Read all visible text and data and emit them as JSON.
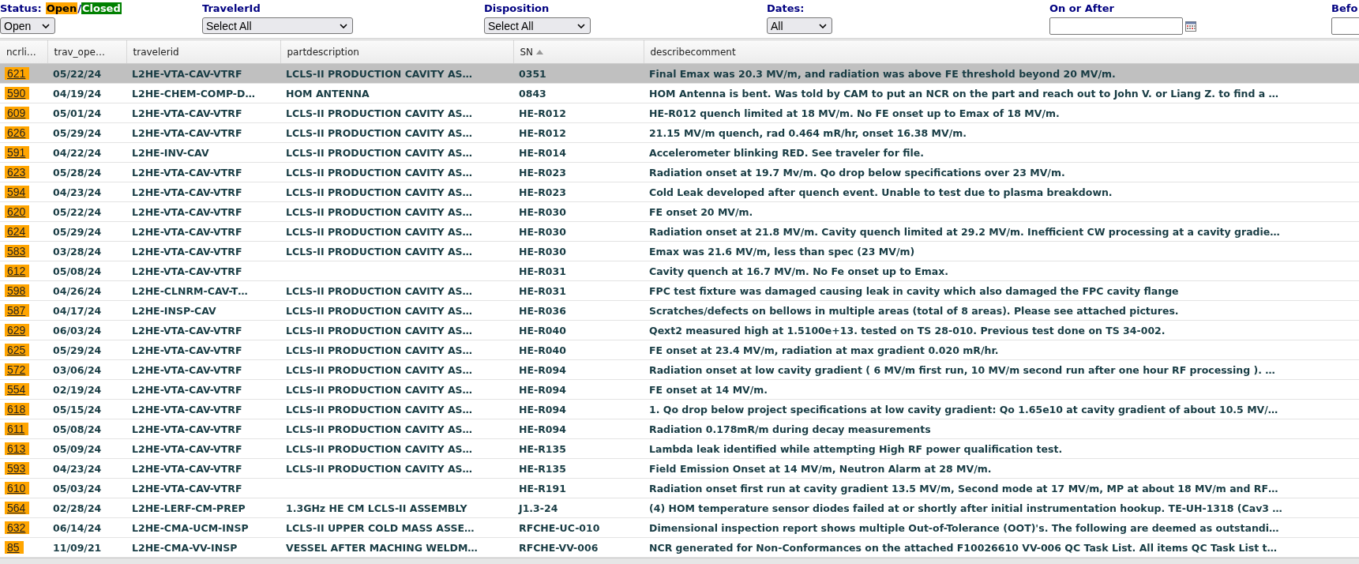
{
  "filters": {
    "status": {
      "label": "Status:",
      "legend": [
        {
          "text": "Open",
          "color": "#ffa500"
        },
        {
          "text": "Closed",
          "color": "#008000"
        }
      ],
      "separator": "/",
      "value": "Open"
    },
    "selects": [
      {
        "label": "TravelerId",
        "value": "Select All"
      },
      {
        "label": "Disposition",
        "value": "Select All"
      },
      {
        "label": "Dates:",
        "value": "All"
      }
    ],
    "date_fields": [
      {
        "label": "On or After",
        "calendar": true
      },
      {
        "label": "Befo"
      }
    ]
  },
  "table": {
    "columns": [
      {
        "label": "ncrli…"
      },
      {
        "label": "trav_ope…"
      },
      {
        "label": "travelerid"
      },
      {
        "label": "partdescription"
      },
      {
        "label": "SN",
        "sorted": true
      },
      {
        "label": "describecomment"
      }
    ],
    "rows": [
      {
        "selected": true,
        "cells": [
          "621",
          "05/22/24",
          "L2HE-VTA-CAV-VTRF",
          "LCLS-II PRODUCTION CAVITY AS…",
          "0351",
          "Final Emax was 20.3 MV/m, and radiation was above FE threshold beyond 20 MV/m."
        ]
      },
      {
        "selected": false,
        "cells": [
          "590",
          "04/19/24",
          "L2HE-CHEM-COMP-D…",
          "HOM ANTENNA",
          "0843",
          "HOM Antenna is bent. Was told by CAM to put an NCR on the part and reach out to John V. or Liang Z. to find a …"
        ]
      },
      {
        "selected": false,
        "cells": [
          "609",
          "05/01/24",
          "L2HE-VTA-CAV-VTRF",
          "LCLS-II PRODUCTION CAVITY AS…",
          "HE-R012",
          "HE-R012 quench limited at 18 MV/m. No FE onset up to Emax of 18 MV/m."
        ]
      },
      {
        "selected": false,
        "cells": [
          "626",
          "05/29/24",
          "L2HE-VTA-CAV-VTRF",
          "LCLS-II PRODUCTION CAVITY AS…",
          "HE-R012",
          "21.15 MV/m quench, rad 0.464 mR/hr, onset 16.38 MV/m."
        ]
      },
      {
        "selected": false,
        "cells": [
          "591",
          "04/22/24",
          "L2HE-INV-CAV",
          "LCLS-II PRODUCTION CAVITY AS…",
          "HE-R014",
          "Accelerometer blinking RED. See traveler for file."
        ]
      },
      {
        "selected": false,
        "cells": [
          "623",
          "05/28/24",
          "L2HE-VTA-CAV-VTRF",
          "LCLS-II PRODUCTION CAVITY AS…",
          "HE-R023",
          "Radiation onset at 19.7 Mv/m. Qo drop below specifications over 23 MV/m."
        ]
      },
      {
        "selected": false,
        "cells": [
          "594",
          "04/23/24",
          "L2HE-VTA-CAV-VTRF",
          "LCLS-II PRODUCTION CAVITY AS…",
          "HE-R023",
          "Cold Leak developed after quench event. Unable to test due to plasma breakdown."
        ]
      },
      {
        "selected": false,
        "cells": [
          "620",
          "05/22/24",
          "L2HE-VTA-CAV-VTRF",
          "LCLS-II PRODUCTION CAVITY AS…",
          "HE-R030",
          "FE onset 20 MV/m."
        ]
      },
      {
        "selected": false,
        "cells": [
          "624",
          "05/29/24",
          "L2HE-VTA-CAV-VTRF",
          "LCLS-II PRODUCTION CAVITY AS…",
          "HE-R030",
          "Radiation onset at 21.8 MV/m. Cavity quench limited at 29.2 MV/m. Inefficient CW processing at a cavity gradie…"
        ]
      },
      {
        "selected": false,
        "cells": [
          "583",
          "03/28/24",
          "L2HE-VTA-CAV-VTRF",
          "LCLS-II PRODUCTION CAVITY AS…",
          "HE-R030",
          "Emax was 21.6 MV/m, less than spec (23 MV/m)"
        ]
      },
      {
        "selected": false,
        "cells": [
          "612",
          "05/08/24",
          "L2HE-VTA-CAV-VTRF",
          "",
          "HE-R031",
          "Cavity quench at 16.7 MV/m. No Fe onset up to Emax."
        ]
      },
      {
        "selected": false,
        "cells": [
          "598",
          "04/26/24",
          "L2HE-CLNRM-CAV-T…",
          "LCLS-II PRODUCTION CAVITY AS…",
          "HE-R031",
          "FPC test fixture was damaged causing leak in cavity which also damaged the FPC cavity flange"
        ]
      },
      {
        "selected": false,
        "cells": [
          "587",
          "04/17/24",
          "L2HE-INSP-CAV",
          "LCLS-II PRODUCTION CAVITY AS…",
          "HE-R036",
          "Scratches/defects on bellows in multiple areas (total of 8 areas). Please see attached pictures."
        ]
      },
      {
        "selected": false,
        "cells": [
          "629",
          "06/03/24",
          "L2HE-VTA-CAV-VTRF",
          "LCLS-II PRODUCTION CAVITY AS…",
          "HE-R040",
          "Qext2 measured high at 1.5100e+13. tested on TS 28-010. Previous test done on TS 34-002."
        ]
      },
      {
        "selected": false,
        "cells": [
          "625",
          "05/29/24",
          "L2HE-VTA-CAV-VTRF",
          "LCLS-II PRODUCTION CAVITY AS…",
          "HE-R040",
          "FE onset at 23.4 MV/m, radiation at max gradient 0.020 mR/hr."
        ]
      },
      {
        "selected": false,
        "cells": [
          "572",
          "03/06/24",
          "L2HE-VTA-CAV-VTRF",
          "LCLS-II PRODUCTION CAVITY AS…",
          "HE-R094",
          "Radiation onset at low cavity gradient ( 6 MV/m first run, 10 MV/m second run after one hour RF processing ). …"
        ]
      },
      {
        "selected": false,
        "cells": [
          "554",
          "02/19/24",
          "L2HE-VTA-CAV-VTRF",
          "LCLS-II PRODUCTION CAVITY AS…",
          "HE-R094",
          "FE onset at 14 MV/m."
        ]
      },
      {
        "selected": false,
        "cells": [
          "618",
          "05/15/24",
          "L2HE-VTA-CAV-VTRF",
          "LCLS-II PRODUCTION CAVITY AS…",
          "HE-R094",
          "1. Qo drop below project specifications at low cavity gradient: Qo 1.65e10 at cavity gradient of about 10.5 MV/…"
        ]
      },
      {
        "selected": false,
        "cells": [
          "611",
          "05/08/24",
          "L2HE-VTA-CAV-VTRF",
          "LCLS-II PRODUCTION CAVITY AS…",
          "HE-R094",
          "Radiation 0.178mR/m during decay measurements"
        ]
      },
      {
        "selected": false,
        "cells": [
          "613",
          "05/09/24",
          "L2HE-VTA-CAV-VTRF",
          "LCLS-II PRODUCTION CAVITY AS…",
          "HE-R135",
          "Lambda leak identified while attempting High RF power qualification test."
        ]
      },
      {
        "selected": false,
        "cells": [
          "593",
          "04/23/24",
          "L2HE-VTA-CAV-VTRF",
          "LCLS-II PRODUCTION CAVITY AS…",
          "HE-R135",
          "Field Emission Onset at 14 MV/m, Neutron Alarm at 28 MV/m."
        ]
      },
      {
        "selected": false,
        "cells": [
          "610",
          "05/03/24",
          "L2HE-VTA-CAV-VTRF",
          "",
          "HE-R191",
          "Radiation onset first run at cavity gradient 13.5 MV/m, Second mode at 17 MV/m, MP at about 18 MV/m and RF…"
        ]
      },
      {
        "selected": false,
        "cells": [
          "564",
          "02/28/24",
          "L2HE-LERF-CM-PREP",
          "1.3GHz HE CM LCLS-II ASSEMBLY",
          "J1.3-24",
          "(4) HOM temperature sensor diodes failed at or shortly after initial instrumentation hookup. TE-UH-1318 (Cav3 …"
        ]
      },
      {
        "selected": false,
        "cells": [
          "632",
          "06/14/24",
          "L2HE-CMA-UCM-INSP",
          "LCLS-II UPPER COLD MASS ASSE…",
          "RFCHE-UC-010",
          "Dimensional inspection report shows multiple Out-of-Tolerance (OOT)'s. The following are deemed as outstandi…"
        ]
      },
      {
        "selected": false,
        "cells": [
          "85",
          "11/09/21",
          "L2HE-CMA-VV-INSP",
          "VESSEL AFTER MACHING WELDM…",
          "RFCHE-VV-006",
          "NCR generated for Non-Conformances on the attached F10026610 VV-006 QC Task List. All items QC Task List t…"
        ]
      }
    ]
  }
}
